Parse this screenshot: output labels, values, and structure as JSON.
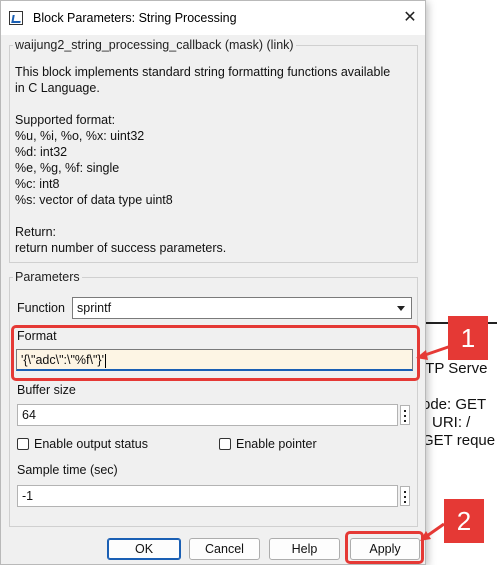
{
  "window": {
    "title": "Block Parameters: String Processing",
    "close_glyph": "✕"
  },
  "mask_group": {
    "label": "waijung2_string_processing_callback (mask) (link)",
    "description_lines": [
      "This block implements standard string formatting functions available",
      "in C Language.",
      "",
      "Supported format:",
      "%u, %i, %o, %x: uint32",
      "%d: int32",
      "%e, %g, %f: single",
      "%c: int8",
      "%s: vector of data type uint8",
      "",
      "Return:",
      "return number of success parameters."
    ]
  },
  "parameters": {
    "group_label": "Parameters",
    "function_label": "Function",
    "function_value": "sprintf",
    "format_label": "Format",
    "format_value": "'{\\\"adc\\\":\\\"%f\\\"}'",
    "buffer_label": "Buffer size",
    "buffer_value": "64",
    "enable_output_label": "Enable output status",
    "enable_output_checked": false,
    "enable_pointer_label": "Enable pointer",
    "enable_pointer_checked": false,
    "sample_time_label": "Sample time (sec)",
    "sample_time_value": "-1"
  },
  "buttons": {
    "ok": "OK",
    "cancel": "Cancel",
    "help": "Help",
    "apply": "Apply"
  },
  "annotations": {
    "badge1": "1",
    "badge2": "2",
    "accent_color": "#e53935"
  },
  "background_canvas": {
    "lines": [
      "TTP Serve",
      "ode: GET",
      "URI: /",
      "GET reque"
    ]
  }
}
